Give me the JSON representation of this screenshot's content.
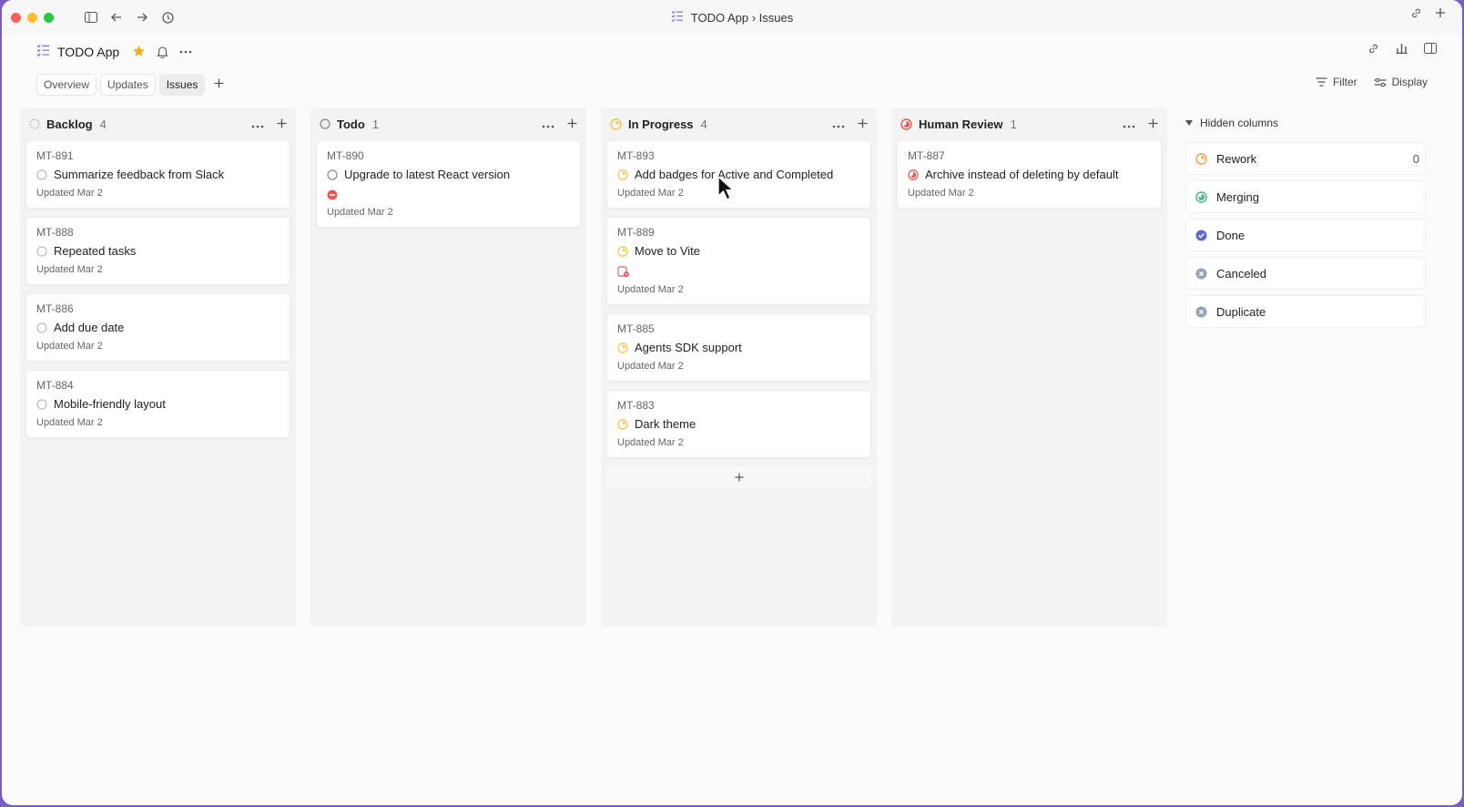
{
  "window": {
    "title": "TODO App › Issues"
  },
  "header": {
    "project_name": "TODO App"
  },
  "tabs": [
    {
      "label": "Overview",
      "active": false
    },
    {
      "label": "Updates",
      "active": false
    },
    {
      "label": "Issues",
      "active": true
    }
  ],
  "toolbar": {
    "filter_label": "Filter",
    "display_label": "Display"
  },
  "columns": [
    {
      "title": "Backlog",
      "count": "4",
      "status": "backlog",
      "cards": [
        {
          "id": "MT-891",
          "title": "Summarize feedback from Slack",
          "updated": "Updated Mar 2"
        },
        {
          "id": "MT-888",
          "title": "Repeated tasks",
          "updated": "Updated Mar 2"
        },
        {
          "id": "MT-886",
          "title": "Add due date",
          "updated": "Updated Mar 2"
        },
        {
          "id": "MT-884",
          "title": "Mobile-friendly layout",
          "updated": "Updated Mar 2"
        }
      ]
    },
    {
      "title": "Todo",
      "count": "1",
      "status": "todo",
      "cards": [
        {
          "id": "MT-890",
          "title": "Upgrade to latest React version",
          "updated": "Updated Mar 2",
          "badge": "blocked-icon"
        }
      ]
    },
    {
      "title": "In Progress",
      "count": "4",
      "status": "in-progress",
      "cards": [
        {
          "id": "MT-893",
          "title": "Add badges for Active and Completed",
          "updated": "Updated Mar 2"
        },
        {
          "id": "MT-889",
          "title": "Move to Vite",
          "updated": "Updated Mar 2",
          "badge": "blocking-icon"
        },
        {
          "id": "MT-885",
          "title": "Agents SDK support",
          "updated": "Updated Mar 2"
        },
        {
          "id": "MT-883",
          "title": "Dark theme",
          "updated": "Updated Mar 2"
        }
      ]
    },
    {
      "title": "Human Review",
      "count": "1",
      "status": "human-review",
      "cards": [
        {
          "id": "MT-887",
          "title": "Archive instead of deleting by default",
          "updated": "Updated Mar 2"
        }
      ]
    }
  ],
  "hidden_columns": {
    "label": "Hidden columns",
    "items": [
      {
        "label": "Rework",
        "count": "0",
        "status": "rework",
        "color": "#f0a040"
      },
      {
        "label": "Merging",
        "status": "merging",
        "color": "#4cb782"
      },
      {
        "label": "Done",
        "status": "done",
        "color": "#5e6ad2"
      },
      {
        "label": "Canceled",
        "status": "canceled",
        "color": "#95a2b3"
      },
      {
        "label": "Duplicate",
        "status": "duplicate",
        "color": "#95a2b3"
      }
    ]
  },
  "colors": {
    "backlog": "#bbbbbb",
    "todo": "#8a8a8a",
    "in_progress": "#f2c94c",
    "human_review": "#eb5757",
    "blocked": "#eb5757",
    "star": "#f2b01e"
  }
}
